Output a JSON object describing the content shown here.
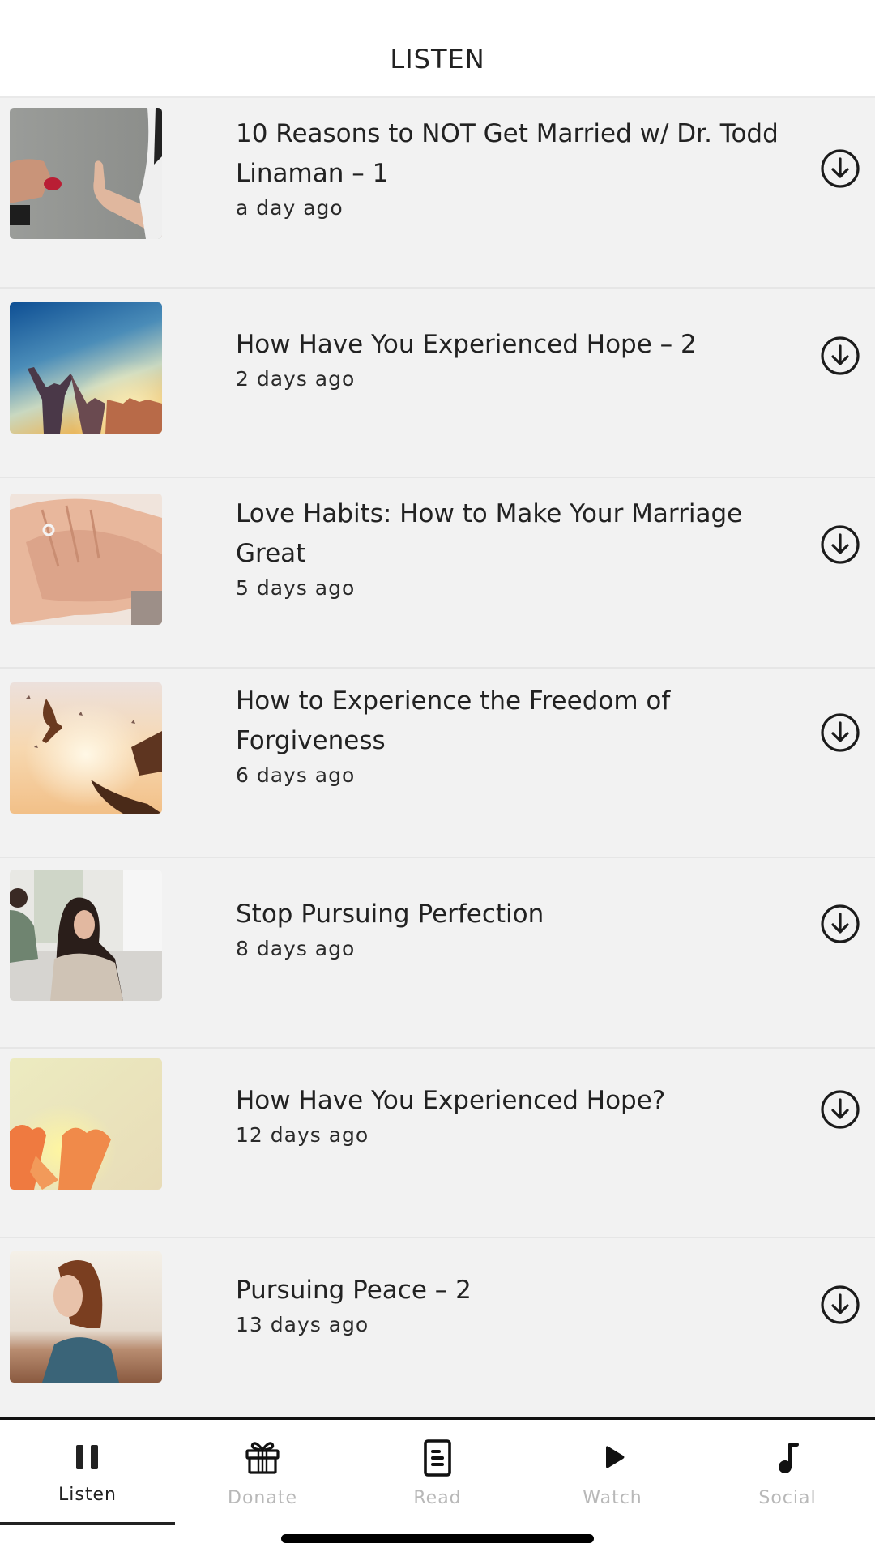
{
  "header": {
    "title": "LISTEN"
  },
  "episodes": [
    {
      "title": "10 Reasons to NOT Get Married w/ Dr. Todd Linaman – 1",
      "date": "a day ago",
      "thumbnail": "hands-refusing-ring-image",
      "download_icon": "download-circle-icon"
    },
    {
      "title": "How Have You Experienced Hope – 2",
      "date": "2 days ago",
      "thumbnail": "people-raising-hands-sunset-image",
      "download_icon": "download-circle-icon"
    },
    {
      "title": "Love Habits: How to Make Your Marriage Great",
      "date": "5 days ago",
      "thumbnail": "hands-with-wedding-ring-image",
      "download_icon": "download-circle-icon"
    },
    {
      "title": "How to Experience the Freedom of Forgiveness",
      "date": "6 days ago",
      "thumbnail": "hands-releasing-birds-image",
      "download_icon": "download-circle-icon"
    },
    {
      "title": "Stop Pursuing Perfection",
      "date": "8 days ago",
      "thumbnail": "couple-on-couch-image",
      "download_icon": "download-circle-icon"
    },
    {
      "title": "How Have You Experienced Hope?",
      "date": "12 days ago",
      "thumbnail": "heart-hands-sunlight-image",
      "download_icon": "download-circle-icon"
    },
    {
      "title": "Pursuing Peace – 2",
      "date": "13 days ago",
      "thumbnail": "woman-eyes-closed-image",
      "download_icon": "download-circle-icon"
    }
  ],
  "tabbar": {
    "active": "Listen",
    "tabs": [
      {
        "label": "Listen",
        "icon": "pause-icon"
      },
      {
        "label": "Donate",
        "icon": "gift-icon"
      },
      {
        "label": "Read",
        "icon": "document-icon"
      },
      {
        "label": "Watch",
        "icon": "play-icon"
      },
      {
        "label": "Social",
        "icon": "music-note-icon"
      }
    ]
  },
  "colors": {
    "list_background": "#f2f2f2",
    "text_primary": "#222222",
    "tab_inactive": "#b8b8b8",
    "accent": "#222222"
  }
}
